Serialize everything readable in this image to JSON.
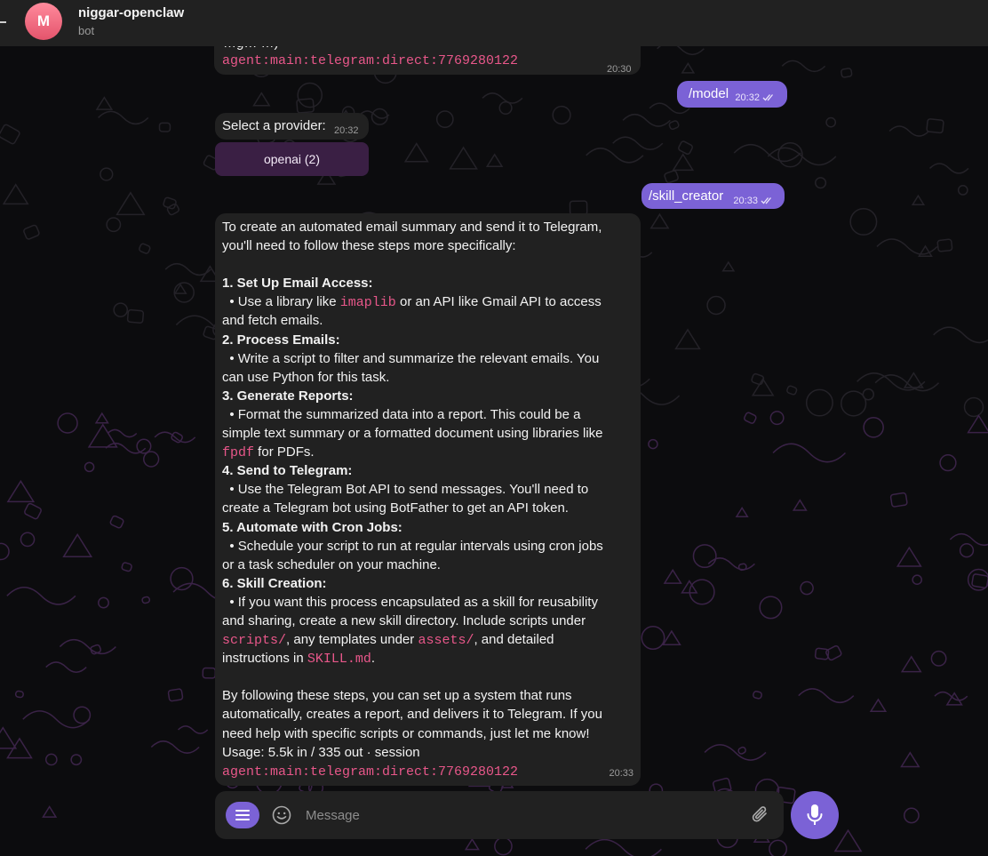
{
  "header": {
    "avatar_letter": "M",
    "title": "niggar-openclaw",
    "subtitle": "bot"
  },
  "messages": {
    "m1": {
      "clipped_text": "…g…  …)",
      "session": "agent:main:telegram:direct:7769280122",
      "time": "20:30"
    },
    "m2": {
      "text": "/model",
      "time": "20:32",
      "status": "read"
    },
    "m3": {
      "text": "Select a provider:",
      "time": "20:32",
      "button_label": "openai (2)"
    },
    "m4": {
      "text": "/skill_creator",
      "time": "20:33",
      "status": "read"
    },
    "m5": {
      "intro1": "To create an automated email summary and send it to Telegram,",
      "intro2": "you'll need to follow these steps more specifically:",
      "s1_title": "1. Set Up Email Access:",
      "s1_a": "  • Use a library like ",
      "s1_code": "imaplib",
      "s1_b": " or an API like Gmail API to access",
      "s1_c": "and fetch emails.",
      "s2_title": "2. Process Emails:",
      "s2_a": "  • Write a script to filter and summarize the relevant emails. You",
      "s2_b": "can use Python for this task.",
      "s3_title": "3. Generate Reports:",
      "s3_a": "  • Format the summarized data into a report. This could be a",
      "s3_b": "simple text summary or a formatted document using libraries like",
      "s3_code": "fpdf",
      "s3_c": " for PDFs.",
      "s4_title": "4. Send to Telegram:",
      "s4_a": "  • Use the Telegram Bot API to send messages. You'll need to",
      "s4_b": "create a Telegram bot using BotFather to get an API token.",
      "s5_title": "5. Automate with Cron Jobs:",
      "s5_a": "  • Schedule your script to run at regular intervals using cron jobs",
      "s5_b": "or a task scheduler on your machine.",
      "s6_title": "6. Skill Creation:",
      "s6_a": "  • If you want this process encapsulated as a skill for reusability",
      "s6_b": "and sharing, create a new skill directory. Include scripts under",
      "s6_code1": "scripts/",
      "s6_c": ", any templates under ",
      "s6_code2": "assets/",
      "s6_d": ", and detailed",
      "s6_e": "instructions in ",
      "s6_code3": "SKILL.md",
      "s6_f": ".",
      "outro1": "By following these steps, you can set up a system that runs",
      "outro2": "automatically, creates a report, and delivers it to Telegram. If you",
      "outro3": "need help with specific scripts or commands, just let me know!",
      "usage": "Usage: 5.5k in / 335 out · session",
      "session": "agent:main:telegram:direct:7769280122",
      "time": "20:33"
    }
  },
  "composer": {
    "placeholder": "Message"
  },
  "colors": {
    "accent": "#7b62d6",
    "code": "#e8578a",
    "bubble_in": "#212121",
    "button_bg": "#3a1f44"
  },
  "icons": [
    "menu-icon",
    "emoji-icon",
    "attach-icon",
    "mic-icon",
    "double-check-icon"
  ]
}
